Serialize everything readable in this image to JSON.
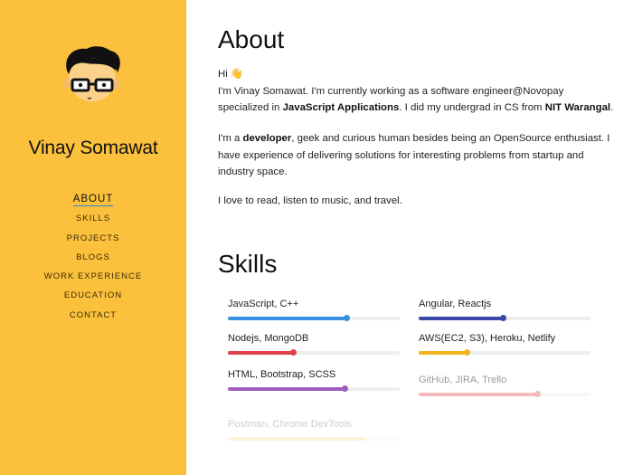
{
  "profile": {
    "name": "Vinay Somawat"
  },
  "nav": {
    "items": [
      "ABOUT",
      "SKILLS",
      "PROJECTS",
      "BLOGS",
      "WORK EXPERIENCE",
      "EDUCATION",
      "CONTACT"
    ],
    "active": "ABOUT"
  },
  "about": {
    "title": "About",
    "greeting": "Hi 👋",
    "line1_a": "I'm Vinay Somawat. I'm currently working as a software engineer@Novopay specialized in ",
    "line1_b": "JavaScript Applications",
    "line1_c": ". I did my undergrad in CS from ",
    "line1_d": "NIT Warangal",
    "line1_e": ".",
    "p2_a": "I'm a ",
    "p2_b": "developer",
    "p2_c": ", geek and curious human besides being an OpenSource enthusiast. I have experience of delivering solutions for interesting problems from startup and industry space.",
    "p3": "I love to read, listen to music, and travel."
  },
  "skills": {
    "title": "Skills",
    "items": [
      {
        "label": "JavaScript, C++",
        "level": 0.69,
        "color": "#3b8fe0"
      },
      {
        "label": "Angular, Reactjs",
        "level": 0.49,
        "color": "#3c46a8"
      },
      {
        "label": "Nodejs, MongoDB",
        "level": 0.38,
        "color": "#e0404a"
      },
      {
        "label": "AWS(EC2, S3), Heroku, Netlify",
        "level": 0.28,
        "color": "#f2b61e"
      },
      {
        "label": "HTML, Bootstrap, SCSS",
        "level": 0.68,
        "color": "#a05dc0"
      },
      {
        "label": "GitHub, JIRA, Trello",
        "level": 0.69,
        "color": "#e86b6b"
      },
      {
        "label": "Postman, Chrome DevTools",
        "level": 0.8,
        "color": "#f7c35a"
      }
    ]
  }
}
